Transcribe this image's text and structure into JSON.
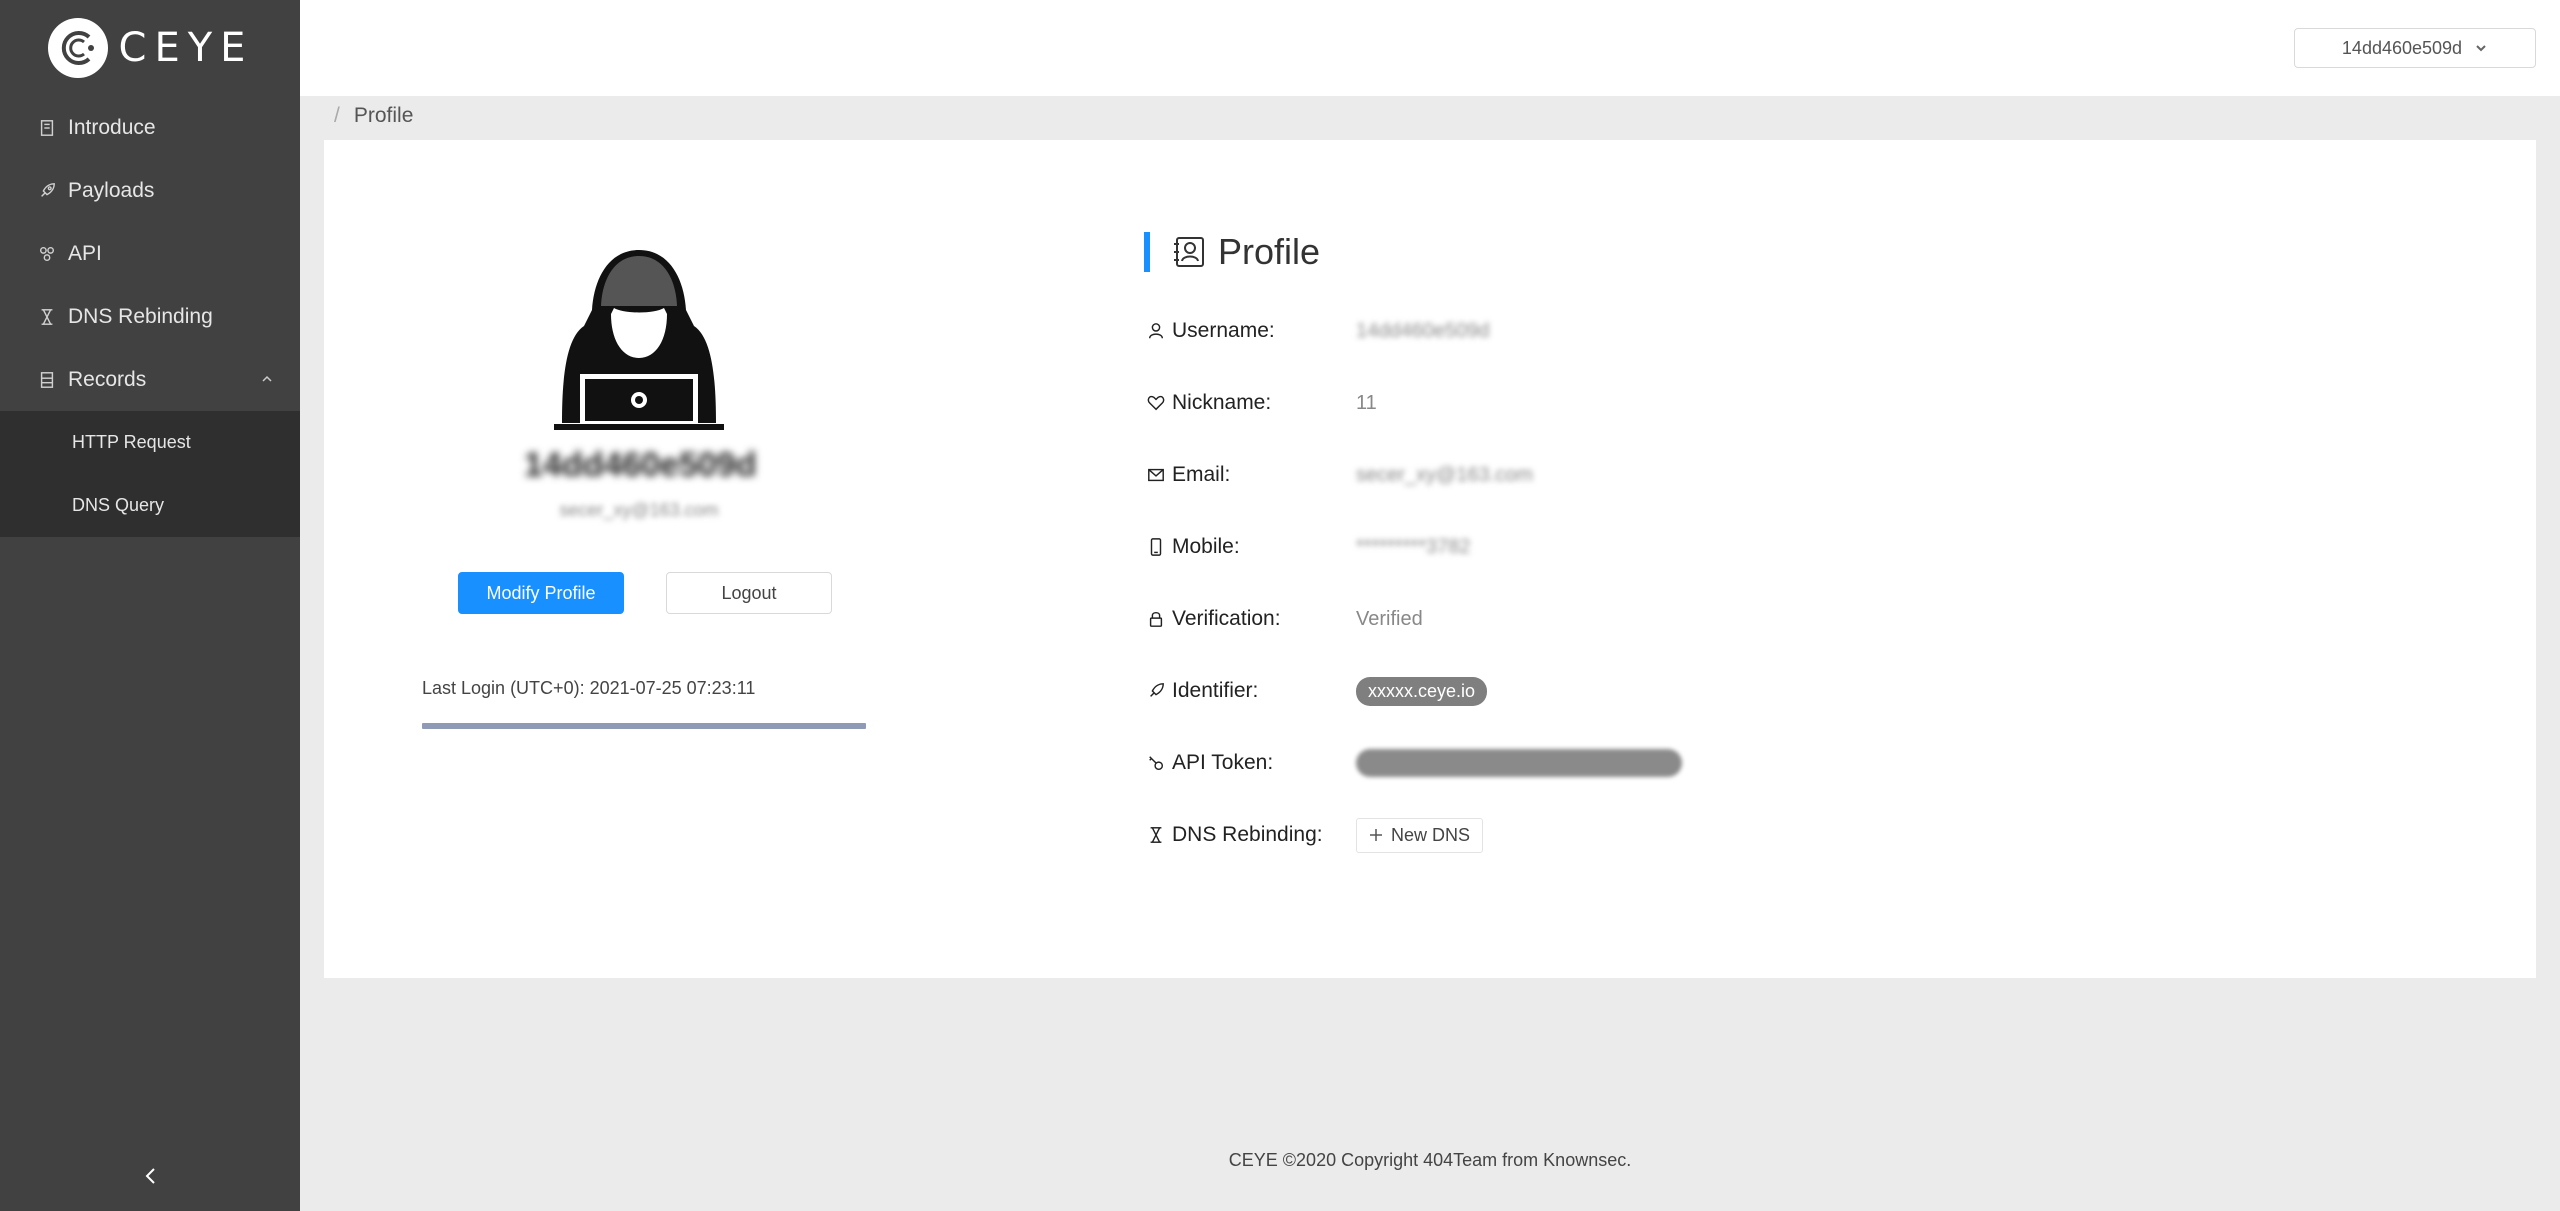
{
  "sidebar": {
    "logo_text": "CEYE",
    "items": [
      {
        "label": "Introduce",
        "icon": "book-icon"
      },
      {
        "label": "Payloads",
        "icon": "rocket-icon"
      },
      {
        "label": "API",
        "icon": "api-icon"
      },
      {
        "label": "DNS Rebinding",
        "icon": "hourglass-icon"
      },
      {
        "label": "Records",
        "icon": "records-icon",
        "expanded": true
      }
    ],
    "subitems": [
      {
        "label": "HTTP Request"
      },
      {
        "label": "DNS Query"
      }
    ]
  },
  "header": {
    "account_label": "14dd460e509d"
  },
  "breadcrumb": {
    "separator": "/",
    "current": "Profile"
  },
  "profile_card": {
    "name": "14dd460e509d",
    "email": "secer_xy@163.com",
    "modify_button": "Modify Profile",
    "logout_button": "Logout",
    "last_login": "Last Login (UTC+0): 2021-07-25 07:23:11"
  },
  "profile": {
    "title": "Profile",
    "fields": {
      "username": {
        "label": "Username:",
        "value": "14dd460e509d"
      },
      "nickname": {
        "label": "Nickname:",
        "value": "11"
      },
      "email": {
        "label": "Email:",
        "value": "secer_xy@163.com"
      },
      "mobile": {
        "label": "Mobile:",
        "value": "*********3782"
      },
      "verification": {
        "label": "Verification:",
        "value": "Verified"
      },
      "identifier": {
        "label": "Identifier:",
        "value": "xxxxx.ceye.io"
      },
      "api_token": {
        "label": "API Token:"
      },
      "dns_rebinding": {
        "label": "DNS Rebinding:",
        "button": "New DNS"
      }
    }
  },
  "footer": {
    "text": "CEYE ©2020 Copyright 404Team from Knownsec."
  },
  "colors": {
    "sidebar_bg": "#414141",
    "submenu_bg": "#2f2f2f",
    "primary": "#1890ff",
    "page_bg": "#ebebeb"
  }
}
